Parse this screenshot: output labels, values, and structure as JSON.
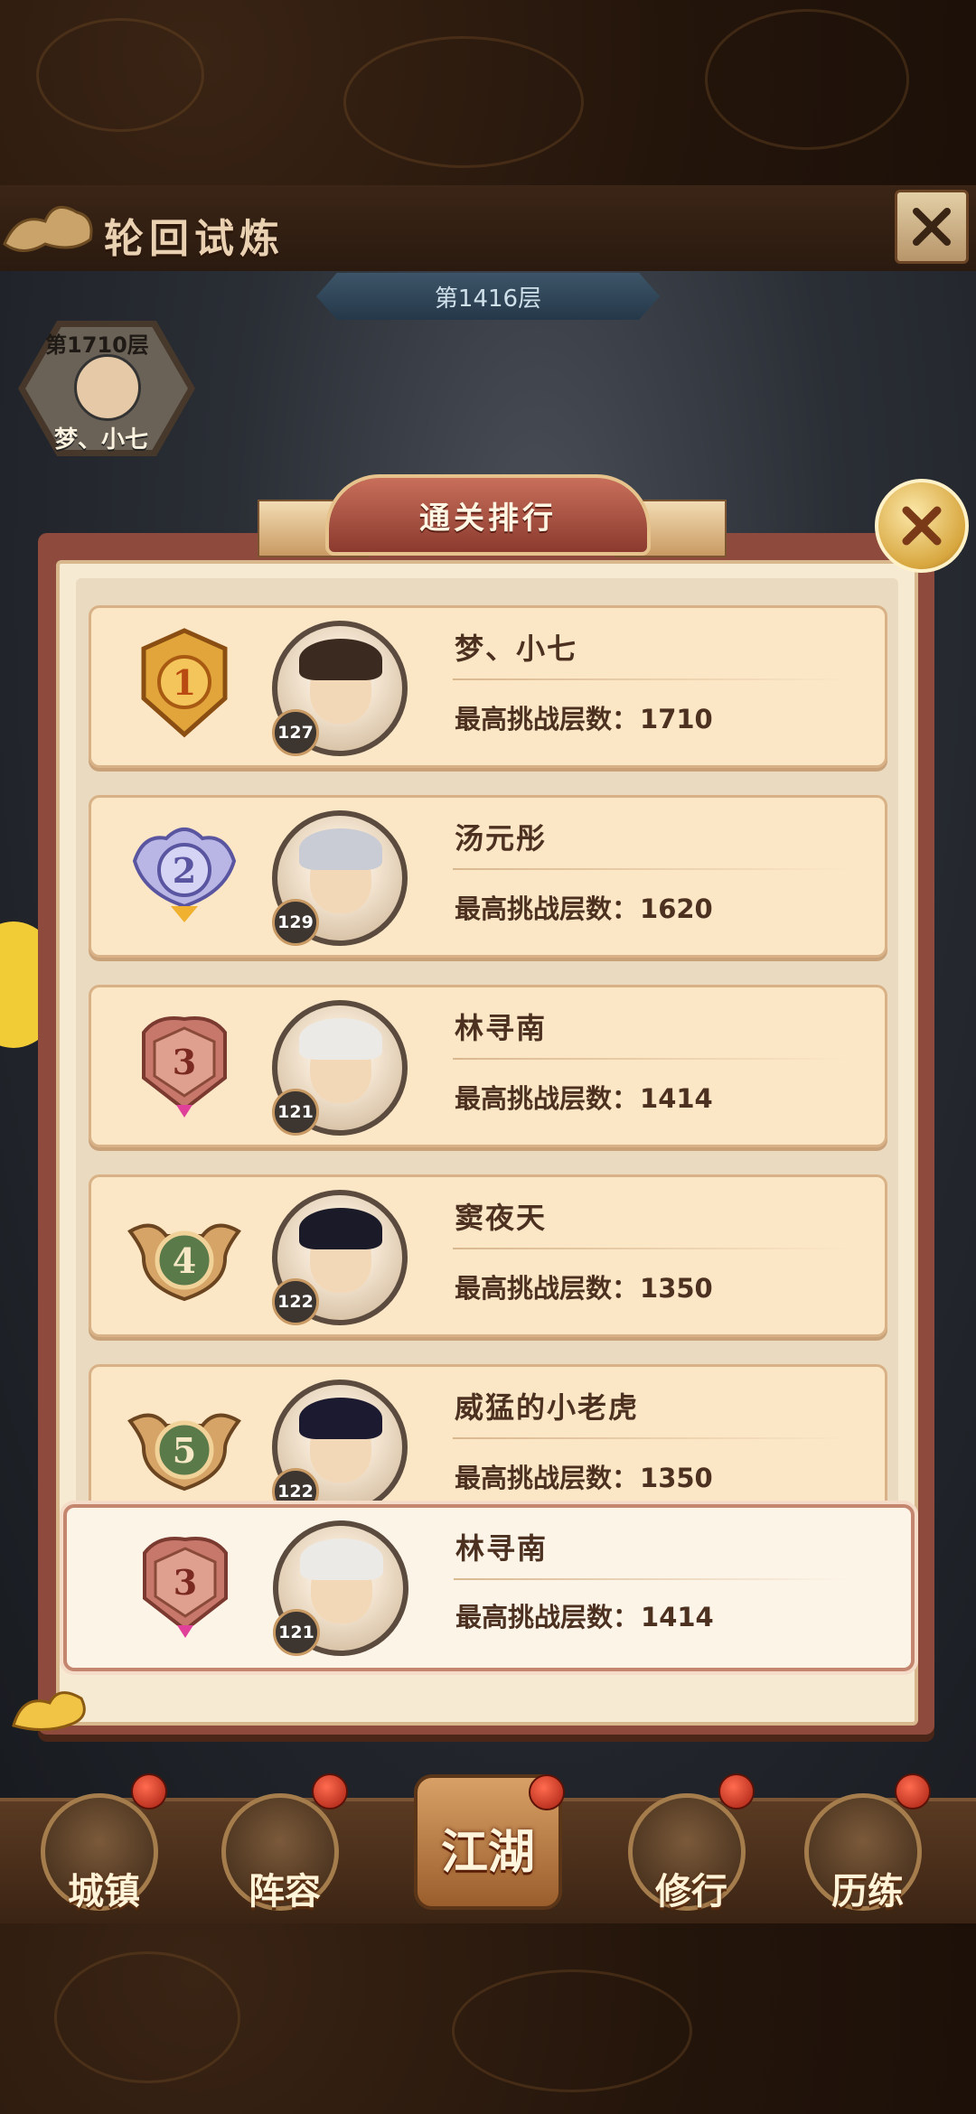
{
  "header": {
    "title": "轮回试炼",
    "current_floor": "第1416层"
  },
  "player_marker": {
    "floor": "第1710层",
    "name": "梦、小七"
  },
  "modal": {
    "title": "通关排行",
    "score_label": "最高挑战层数：",
    "rankings": [
      {
        "rank": "1",
        "name": "梦、小七",
        "level": "127",
        "score": "1710",
        "medal_color": "gold"
      },
      {
        "rank": "2",
        "name": "汤元彤",
        "level": "129",
        "score": "1620",
        "medal_color": "silver"
      },
      {
        "rank": "3",
        "name": "林寻南",
        "level": "121",
        "score": "1414",
        "medal_color": "bronze"
      },
      {
        "rank": "4",
        "name": "窦夜天",
        "level": "122",
        "score": "1350",
        "medal_color": "green"
      },
      {
        "rank": "5",
        "name": "威猛的小老虎",
        "level": "122",
        "score": "1350",
        "medal_color": "green"
      }
    ],
    "my_rank": {
      "rank": "3",
      "name": "林寻南",
      "level": "121",
      "score": "1414"
    }
  },
  "bottom_nav": {
    "items": [
      {
        "label": "城镇",
        "icon": "town-icon"
      },
      {
        "label": "阵容",
        "icon": "lineup-icon"
      },
      {
        "label": "江湖",
        "icon": "jianghu-scroll-icon"
      },
      {
        "label": "修行",
        "icon": "cultivation-icon"
      },
      {
        "label": "历练",
        "icon": "training-icon"
      }
    ]
  },
  "colors": {
    "modal_frame": "#8e4a3c",
    "row_bg": "#fbe6c6",
    "text_brown": "#4c3020",
    "gold_medal": "#e2a53b",
    "silver_medal": "#b9b6e6",
    "bronze_medal": "#c8786a",
    "green_medal": "#5a7a4a"
  }
}
